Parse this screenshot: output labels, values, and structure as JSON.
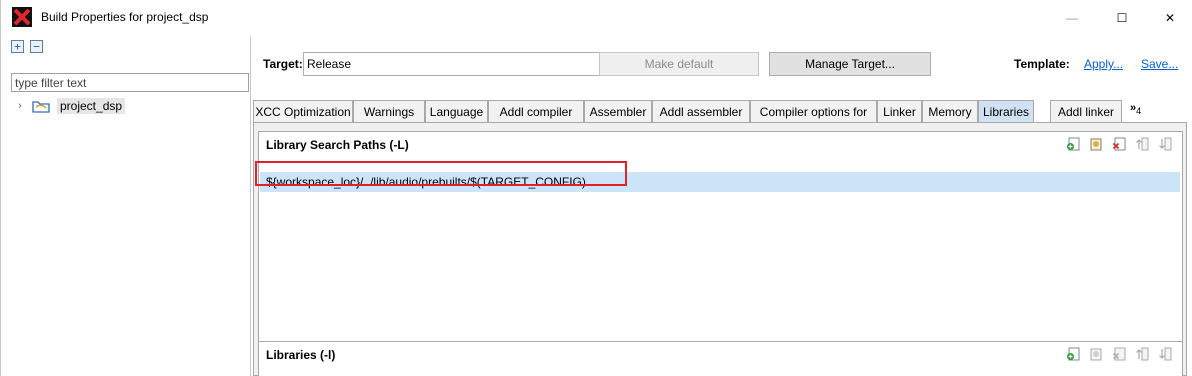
{
  "window": {
    "title": "Build Properties for project_dsp",
    "min_glyph": "—",
    "max_glyph": "☐",
    "close_glyph": "✕"
  },
  "left_panel": {
    "expand_glyph": "+",
    "collapse_glyph": "−",
    "filter_placeholder": "type filter text",
    "tree_chevron": "›",
    "tree_item_label": "project_dsp"
  },
  "target": {
    "label": "Target:",
    "value": "Release",
    "chevron": "⌄",
    "make_default_label": "Make default",
    "manage_label": "Manage Target...",
    "template_label": "Template:",
    "apply_label": "Apply...",
    "save_label": "Save..."
  },
  "tabs": [
    {
      "label": "XCC Optimization"
    },
    {
      "label": "Warnings"
    },
    {
      "label": "Language"
    },
    {
      "label": "Addl compiler"
    },
    {
      "label": "Assembler"
    },
    {
      "label": "Addl assembler"
    },
    {
      "label": "Compiler options for"
    },
    {
      "label": "Linker"
    },
    {
      "label": "Memory"
    },
    {
      "label": "Libraries"
    },
    {
      "label": "Addl linker"
    }
  ],
  "tabs_more": {
    "label": "»",
    "count": "4"
  },
  "library_search": {
    "title": "Library Search Paths (-L)",
    "entries": [
      "${workspace_loc}/../lib/audio/prebuilts/$(TARGET_CONFIG)"
    ]
  },
  "libraries": {
    "title": "Libraries (-l)"
  },
  "colors": {
    "active_tab": "#cfe1f3",
    "selection": "#cce4f7",
    "highlight_box": "#e0202a",
    "link": "#0b5fc4"
  }
}
